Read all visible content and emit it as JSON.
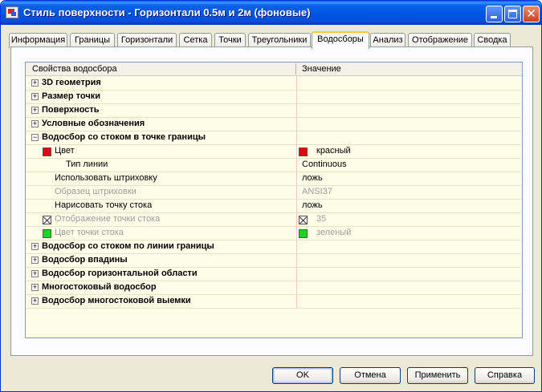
{
  "window": {
    "title": "Стиль поверхности - Горизонтали 0.5м и 2м (фоновые)",
    "icon": "autocad-style-icon",
    "controls": [
      "minimize-icon",
      "maximize-icon",
      "close-icon"
    ],
    "close_glyph": "✕"
  },
  "tabs": [
    {
      "label": "Информация",
      "active": false
    },
    {
      "label": "Границы",
      "active": false
    },
    {
      "label": "Горизонтали",
      "active": false
    },
    {
      "label": "Сетка",
      "active": false
    },
    {
      "label": "Точки",
      "active": false
    },
    {
      "label": "Треугольники",
      "active": false
    },
    {
      "label": "Водосборы",
      "active": true
    },
    {
      "label": "Анализ",
      "active": false
    },
    {
      "label": "Отображение",
      "active": false
    },
    {
      "label": "Сводка",
      "active": false
    }
  ],
  "grid": {
    "col_property": "Свойства водосбора",
    "col_value": "Значение",
    "expander_plus": "+",
    "expander_minus": "−",
    "rows": [
      {
        "label": "3D геометрия",
        "value": ""
      },
      {
        "label": "Размер точки",
        "value": ""
      },
      {
        "label": "Поверхность",
        "value": ""
      },
      {
        "label": "Условные обозначения",
        "value": ""
      },
      {
        "label": "Водосбор со стоком в точке границы",
        "value": ""
      },
      {
        "label": "Цвет",
        "value": "красный"
      },
      {
        "label": "Тип линии",
        "value": "Continuous"
      },
      {
        "label": "Использовать штриховку",
        "value": "ложь"
      },
      {
        "label": "Образец штриховки",
        "value": "ANSI37"
      },
      {
        "label": "Нарисовать точку стока",
        "value": "ложь"
      },
      {
        "label": "Отображение точки стока",
        "value": "35"
      },
      {
        "label": "Цвет точки стока",
        "value": "зеленый"
      },
      {
        "label": "Водосбор со стоком по линии границы",
        "value": ""
      },
      {
        "label": "Водосбор впадины",
        "value": ""
      },
      {
        "label": "Водосбор горизонтальной области",
        "value": ""
      },
      {
        "label": "Многостоковый водосбор",
        "value": ""
      },
      {
        "label": "Водосбор многостоковой выемки",
        "value": ""
      }
    ]
  },
  "colors": {
    "red": "#e60000",
    "green": "#1fd41f"
  },
  "buttons": {
    "ok": "OK",
    "cancel": "Отмена",
    "apply": "Применить",
    "help": "Справка"
  }
}
